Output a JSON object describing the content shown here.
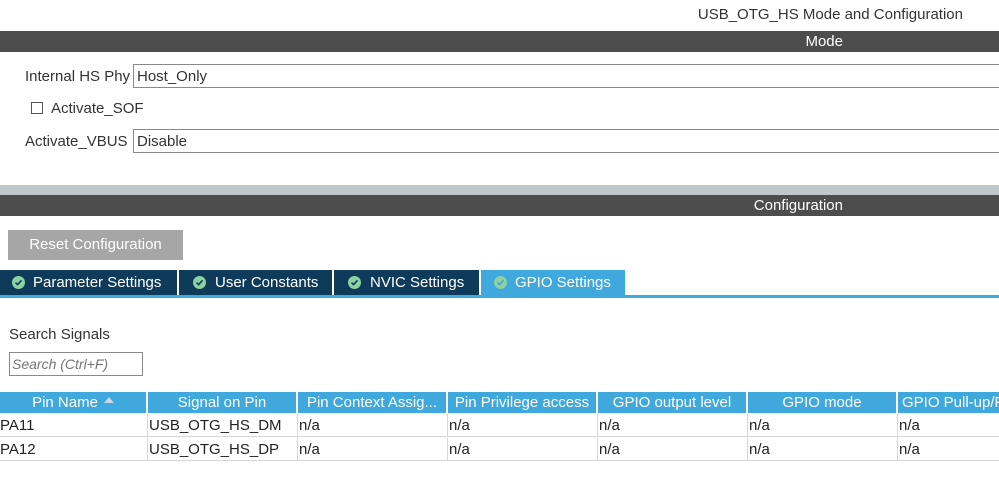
{
  "title": "USB_OTG_HS Mode and Configuration",
  "mode": {
    "header": "Mode",
    "internal_hs_phy": {
      "label": "Internal HS Phy",
      "value": "Host_Only"
    },
    "activate_sof": {
      "label": "Activate_SOF",
      "checked": false
    },
    "activate_vbus": {
      "label": "Activate_VBUS",
      "value": "Disable"
    }
  },
  "configuration": {
    "header": "Configuration",
    "reset_label": "Reset Configuration",
    "tabs": [
      {
        "label": "Parameter Settings",
        "active": false,
        "icon": "check-circle-icon"
      },
      {
        "label": "User Constants",
        "active": false,
        "icon": "check-circle-icon"
      },
      {
        "label": "NVIC Settings",
        "active": false,
        "icon": "check-circle-icon"
      },
      {
        "label": "GPIO Settings",
        "active": true,
        "icon": "check-circle-icon"
      }
    ],
    "search": {
      "label": "Search Signals",
      "placeholder": "Search (Ctrl+F)",
      "value": ""
    },
    "table": {
      "columns": [
        "Pin Name",
        "Signal on Pin",
        "Pin Context Assig...",
        "Pin Privilege access",
        "GPIO output level",
        "GPIO mode",
        "GPIO Pull-up/P"
      ],
      "rows": [
        [
          "PA11",
          "USB_OTG_HS_DM",
          "n/a",
          "n/a",
          "n/a",
          "n/a",
          "n/a"
        ],
        [
          "PA12",
          "USB_OTG_HS_DP",
          "n/a",
          "n/a",
          "n/a",
          "n/a",
          "n/a"
        ]
      ]
    }
  },
  "colors": {
    "header_bg": "#4d4d4d",
    "tab_bg": "#0f3b5a",
    "tab_active_bg": "#3fa8dc",
    "table_header_bg": "#3fa8dc",
    "check_green": "#8ed1a1"
  }
}
